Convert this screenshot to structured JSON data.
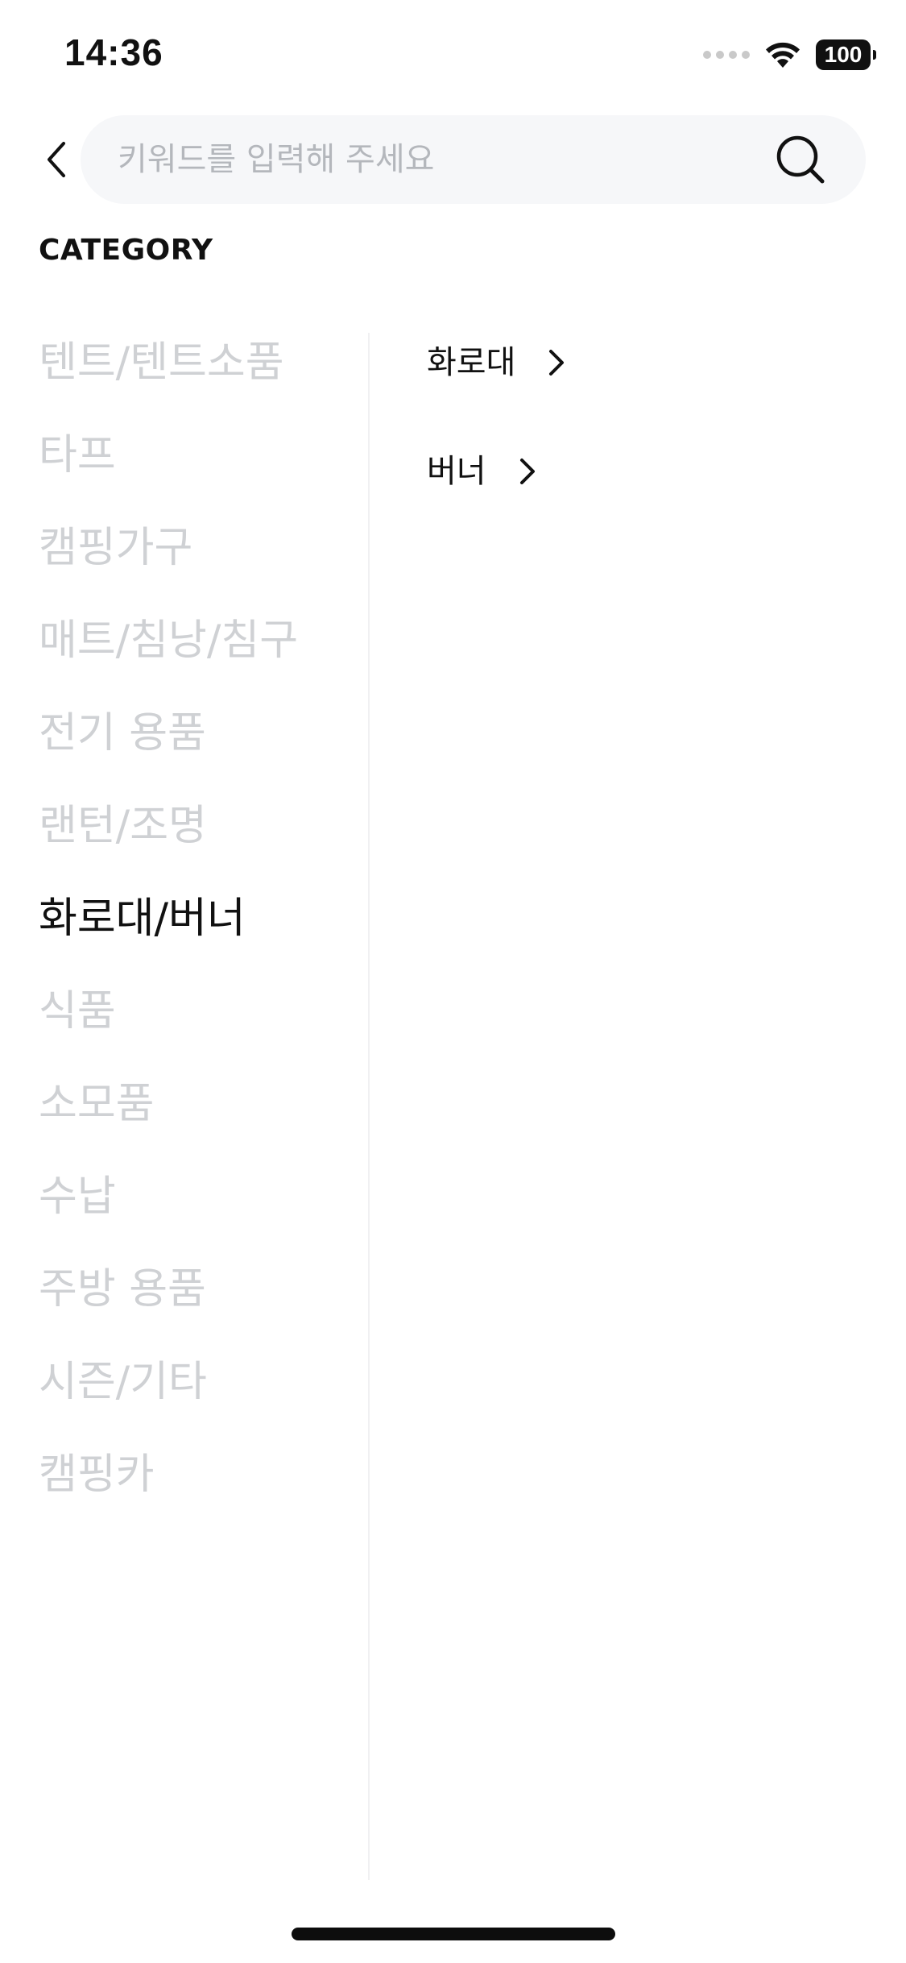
{
  "status_bar": {
    "time": "14:36",
    "battery": "100"
  },
  "search": {
    "placeholder": "키워드를 입력해 주세요",
    "value": ""
  },
  "category_heading": "CATEGORY",
  "categories": [
    {
      "label": "텐트/텐트소품",
      "active": false
    },
    {
      "label": "타프",
      "active": false
    },
    {
      "label": "캠핑가구",
      "active": false
    },
    {
      "label": "매트/침낭/침구",
      "active": false
    },
    {
      "label": "전기 용품",
      "active": false
    },
    {
      "label": "랜턴/조명",
      "active": false
    },
    {
      "label": "화로대/버너",
      "active": true
    },
    {
      "label": "식품",
      "active": false
    },
    {
      "label": "소모품",
      "active": false
    },
    {
      "label": "수납",
      "active": false
    },
    {
      "label": "주방 용품",
      "active": false
    },
    {
      "label": "시즌/기타",
      "active": false
    },
    {
      "label": "캠핑카",
      "active": false
    }
  ],
  "subcategories": [
    {
      "label": "화로대"
    },
    {
      "label": "버너"
    }
  ],
  "icons": {
    "back": "chevron-left-icon",
    "search": "search-icon",
    "subcategory": "chevron-right-icon"
  },
  "colors": {
    "active_text": "#111111",
    "inactive_text": "#cfd1d4",
    "search_bg": "#f6f7f9"
  }
}
